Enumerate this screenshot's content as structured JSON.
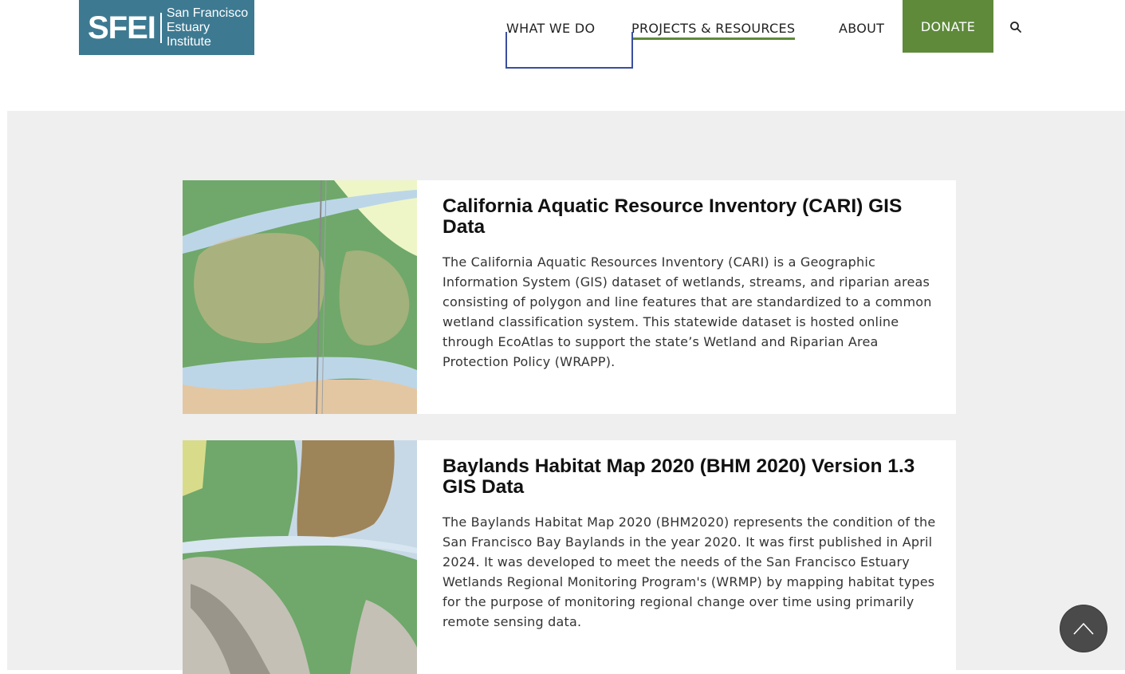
{
  "header": {
    "logo_mark": "SFEI",
    "logo_line1": "San Francisco",
    "logo_line2": "Estuary Institute",
    "nav": [
      {
        "label": "WHAT WE DO"
      },
      {
        "label": "PROJECTS & RESOURCES"
      },
      {
        "label": "ABOUT"
      }
    ],
    "donate_label": "DONATE",
    "search_icon": "search-icon"
  },
  "cards": [
    {
      "title": "California Aquatic Resource Inventory (CARI) GIS Data",
      "description": "The California Aquatic Resources Inventory (CARI) is a Geographic Information System (GIS) dataset of wetlands, streams, and riparian areas consisting of polygon and line features that are standardized to a common wetland classification system.  This statewide dataset is hosted online through EcoAtlas to support the state’s Wetland and Riparian Area Protection Policy (WRAPP)."
    },
    {
      "title": "Baylands Habitat Map 2020 (BHM 2020) Version 1.3 GIS Data",
      "description": "The Baylands Habitat Map 2020 (BHM2020) represents the condition of the San Francisco Bay Baylands in the year 2020. It was first published in April 2024. It was developed to meet the needs of the San Francisco Estuary Wetlands Regional Monitoring Program's (WRMP) by mapping habitat types for the purpose of monitoring regional change over time using primarily remote sensing data."
    }
  ],
  "colors": {
    "brand_blue": "#3d7a92",
    "accent_green": "#5e8a3a",
    "page_gray": "#efefef"
  }
}
